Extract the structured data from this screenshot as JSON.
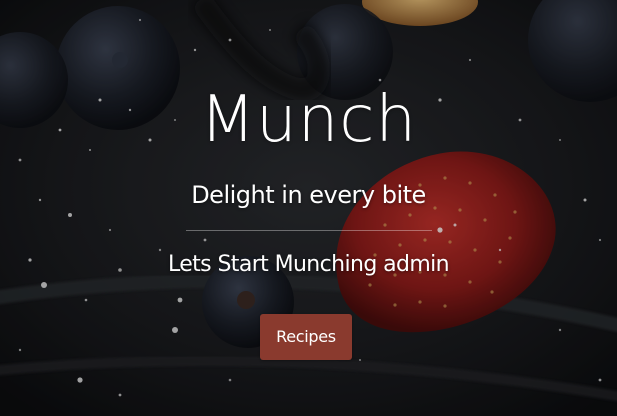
{
  "hero": {
    "title": "Munch",
    "tagline": "Delight in every bite",
    "subline": "Lets Start Munching admin",
    "cta_label": "Recipes"
  },
  "colors": {
    "button_background": "#8a3a2e",
    "text": "#ffffff",
    "background": "#141517"
  },
  "background_image": "dark-food-photo-blueberries-strawberry-powdered-sugar"
}
